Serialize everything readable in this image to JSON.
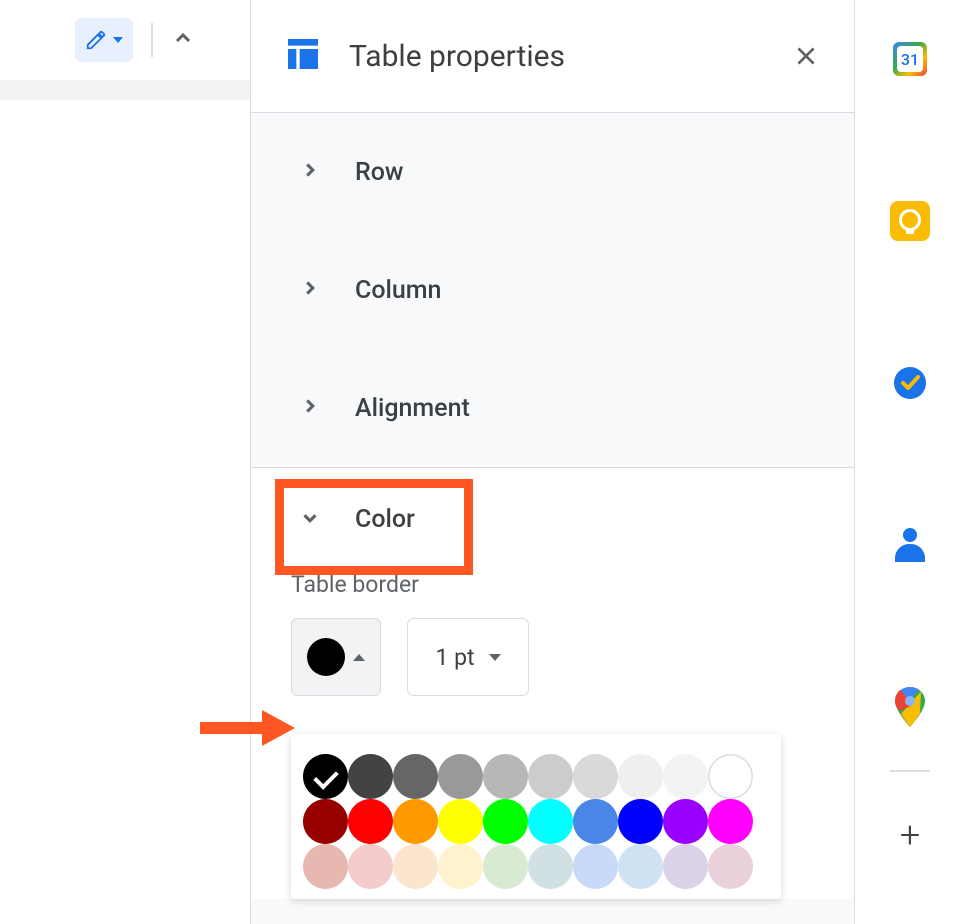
{
  "panel": {
    "title": "Table properties",
    "sections": [
      {
        "label": "Row"
      },
      {
        "label": "Column"
      },
      {
        "label": "Alignment"
      }
    ],
    "color_section": {
      "label": "Color",
      "border_label": "Table border",
      "selected_color": "#000000",
      "border_width": "1 pt"
    }
  },
  "palette": {
    "row1": [
      "#000000",
      "#434343",
      "#666666",
      "#999999",
      "#b7b7b7",
      "#cccccc",
      "#d9d9d9",
      "#efefef",
      "#f3f3f3",
      "#ffffff"
    ],
    "row2": [
      "#980000",
      "#ff0000",
      "#ff9900",
      "#ffff00",
      "#00ff00",
      "#00ffff",
      "#4a86e8",
      "#0000ff",
      "#9900ff",
      "#ff00ff"
    ],
    "row3": [
      "#e6b8af",
      "#f4cccc",
      "#fce5cd",
      "#fff2cc",
      "#d9ead3",
      "#d0e0e3",
      "#c9daf8",
      "#cfe2f3",
      "#d9d2e9",
      "#ead1dc"
    ]
  },
  "calendar": {
    "date": "31"
  }
}
